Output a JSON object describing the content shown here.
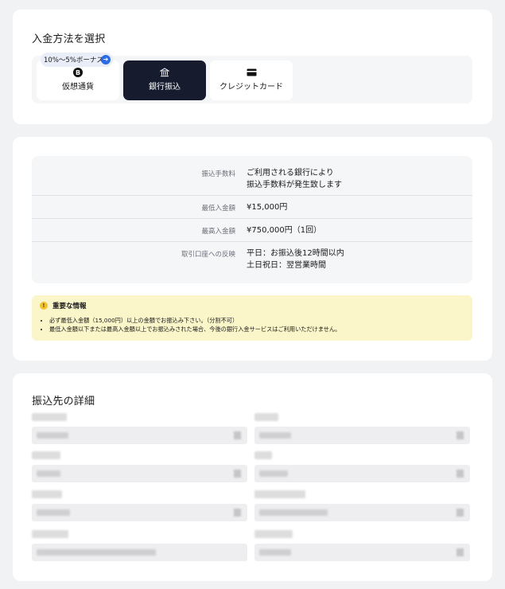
{
  "select_method": {
    "title": "入金方法を選択",
    "bonus_badge": "10%〜5%ボーナス",
    "methods": [
      {
        "label": "仮想通貨",
        "icon": "bitcoin-icon",
        "selected": false
      },
      {
        "label": "銀行振込",
        "icon": "bank-icon",
        "selected": true
      },
      {
        "label": "クレジットカード",
        "icon": "credit-card-icon",
        "selected": false
      }
    ]
  },
  "transfer_info": {
    "rows": [
      {
        "key": "振込手数料",
        "value_lines": [
          "ご利用される銀行により",
          "振込手数料が発生致します"
        ]
      },
      {
        "key": "最低入金額",
        "value_lines": [
          "¥15,000円"
        ]
      },
      {
        "key": "最高入金額",
        "value_lines": [
          "¥750,000円（1回）"
        ]
      },
      {
        "key": "取引口座への反映",
        "value_lines": [
          "平日：お振込後12時間以内",
          "土日祝日：翌営業時間"
        ]
      }
    ]
  },
  "notice": {
    "title": "重要な情報",
    "items": [
      "必ず最低入金額（15,000円）以上の金額でお振込み下さい。（分割不可）",
      "最低入金額以下または最高入金額以上でお振込みされた場合、今後の銀行入金サービスはご利用いただけません。"
    ]
  },
  "transfer_details": {
    "title": "振込先の詳細"
  },
  "colors": {
    "selected_method_bg": "#161b2e",
    "badge_arrow": "#2b6be6",
    "notice_bg": "#faf6c9",
    "warning_icon": "#f2c230"
  }
}
